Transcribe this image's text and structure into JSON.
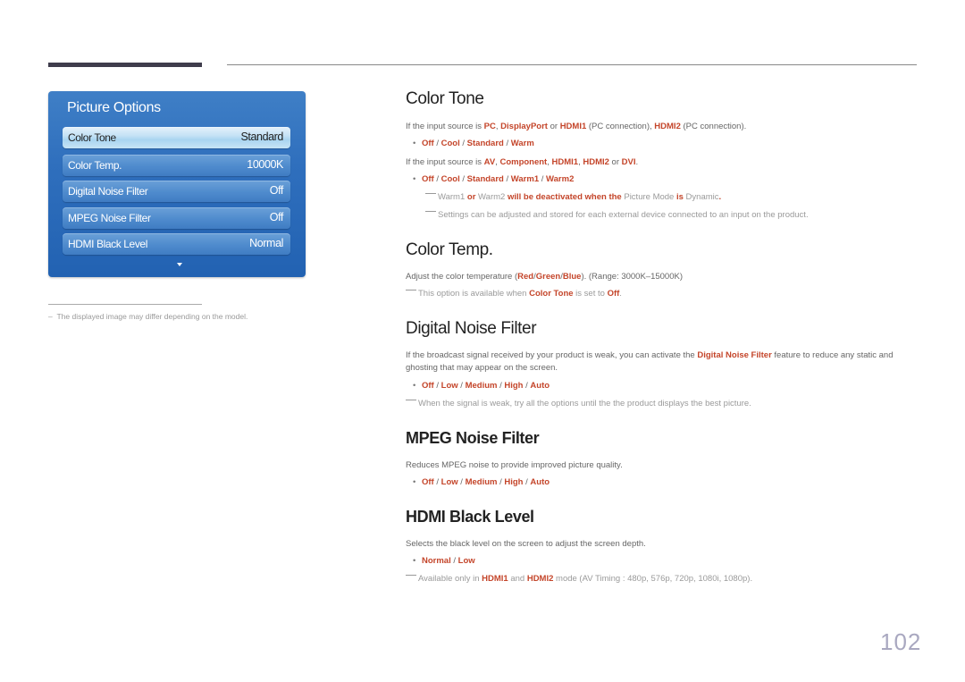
{
  "menu": {
    "title": "Picture Options",
    "items": [
      {
        "label": "Color Tone",
        "value": "Standard",
        "selected": true
      },
      {
        "label": "Color Temp.",
        "value": "10000K"
      },
      {
        "label": "Digital Noise Filter",
        "value": "Off"
      },
      {
        "label": "MPEG Noise Filter",
        "value": "Off"
      },
      {
        "label": "HDMI Black Level",
        "value": "Normal"
      }
    ],
    "scroll_icon": "triangle-down"
  },
  "footnote": "The displayed image may differ depending on the model.",
  "sections": {
    "color_tone": {
      "title": "Color Tone",
      "p1": [
        "If the input source is ",
        "PC",
        ", ",
        "DisplayPort",
        " or ",
        "HDMI1",
        " (PC connection), ",
        "HDMI2",
        " (PC connection)."
      ],
      "opts1": [
        "Off",
        "Cool",
        "Standard",
        "Warm"
      ],
      "p2": [
        "If the input source is ",
        "AV",
        ", ",
        "Component",
        ", ",
        "HDMI1",
        ", ",
        "HDMI2",
        " or ",
        "DVI",
        "."
      ],
      "opts2": [
        "Off",
        "Cool",
        "Standard",
        "Warm1",
        "Warm2"
      ],
      "note1": [
        "Warm1",
        " or ",
        "Warm2",
        " will be deactivated when the ",
        "Picture Mode",
        " is ",
        "Dynamic",
        "."
      ],
      "note2": "Settings can be adjusted and stored for each external device connected to an input on the product."
    },
    "color_temp": {
      "title": "Color Temp.",
      "p1": [
        "Adjust the color temperature (",
        "Red",
        "/",
        "Green",
        "/",
        "Blue",
        "). (Range: 3000K–15000K)"
      ],
      "note1": [
        "This option is available when ",
        "Color Tone",
        " is set to ",
        "Off",
        "."
      ]
    },
    "digital_noise": {
      "title": "Digital Noise Filter",
      "p1": [
        "If the broadcast signal received by your product is weak, you can activate the ",
        "Digital Noise Filter",
        " feature to reduce any static and ghosting that may appear on the screen."
      ],
      "opts": [
        "Off",
        "Low",
        "Medium",
        "High",
        "Auto"
      ],
      "note1": "When the signal is weak, try all the options until the the product displays the best picture."
    },
    "mpeg_noise": {
      "title": "MPEG Noise Filter",
      "p1": "Reduces MPEG noise to provide improved picture quality.",
      "opts": [
        "Off",
        "Low",
        "Medium",
        "High",
        "Auto"
      ]
    },
    "hdmi_black": {
      "title": "HDMI Black Level",
      "p1": "Selects the black level on the screen to adjust the screen depth.",
      "opts": [
        "Normal",
        "Low"
      ],
      "note1": [
        "Available only in ",
        "HDMI1",
        " and ",
        "HDMI2",
        " mode (AV Timing : 480p, 576p, 720p, 1080i, 1080p)."
      ]
    }
  },
  "page_number": "102",
  "colors": {
    "accent": "#c4452a",
    "panel_blue": "#2f6fbd"
  }
}
